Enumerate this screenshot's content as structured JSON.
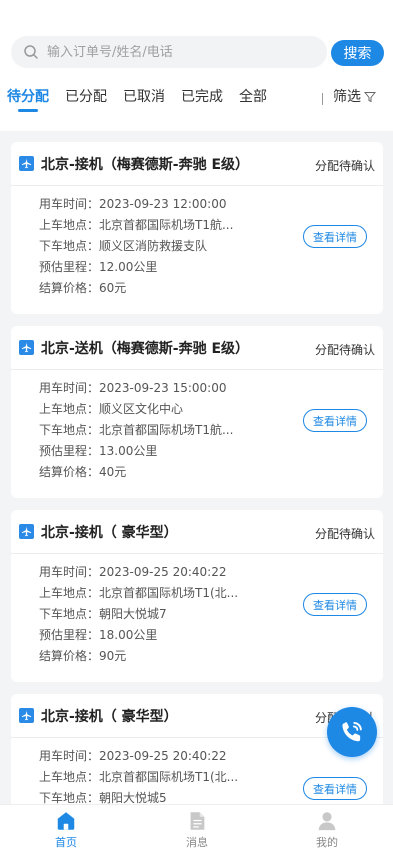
{
  "search": {
    "placeholder": "输入订单号/姓名/电话",
    "button_label": "搜索"
  },
  "tabs": [
    {
      "label": "待分配",
      "active": true
    },
    {
      "label": "已分配",
      "active": false
    },
    {
      "label": "已取消",
      "active": false
    },
    {
      "label": "已完成",
      "active": false
    },
    {
      "label": "全部",
      "active": false
    }
  ],
  "filter_label": "筛选",
  "detail_label": "查看详情",
  "field_labels": {
    "time": "用车时间：",
    "pickup": "上车地点：",
    "dropoff": "下车地点：",
    "distance": "预估里程：",
    "price": "结算价格："
  },
  "orders": [
    {
      "title": "北京-接机（梅赛德斯-奔驰 E级）",
      "status": "分配待确认",
      "time": "2023-09-23 12:00:00",
      "pickup": "北京首都国际机场T1航...",
      "dropoff": "顺义区消防救援支队",
      "distance": "12.00公里",
      "price": "60元"
    },
    {
      "title": "北京-送机（梅赛德斯-奔驰 E级）",
      "status": "分配待确认",
      "time": "2023-09-23 15:00:00",
      "pickup": "顺义区文化中心",
      "dropoff": "北京首都国际机场T1航...",
      "distance": "13.00公里",
      "price": "40元"
    },
    {
      "title": "北京-接机（ 豪华型）",
      "status": "分配待确认",
      "time": "2023-09-25 20:40:22",
      "pickup": "北京首都国际机场T1(北...",
      "dropoff": "朝阳大悦城7",
      "distance": "18.00公里",
      "price": "90元"
    },
    {
      "title": "北京-接机（ 豪华型）",
      "status": "分配待确认",
      "time": "2023-09-25 20:40:22",
      "pickup": "北京首都国际机场T1(北...",
      "dropoff": "朝阳大悦城5",
      "distance": "",
      "price": ""
    }
  ],
  "bottom_nav": [
    {
      "label": "首页",
      "icon": "home-icon",
      "active": true
    },
    {
      "label": "消息",
      "icon": "message-icon",
      "active": false
    },
    {
      "label": "我的",
      "icon": "user-icon",
      "active": false
    }
  ],
  "colors": {
    "accent": "#1e88e5",
    "background": "#f3f4f6"
  }
}
